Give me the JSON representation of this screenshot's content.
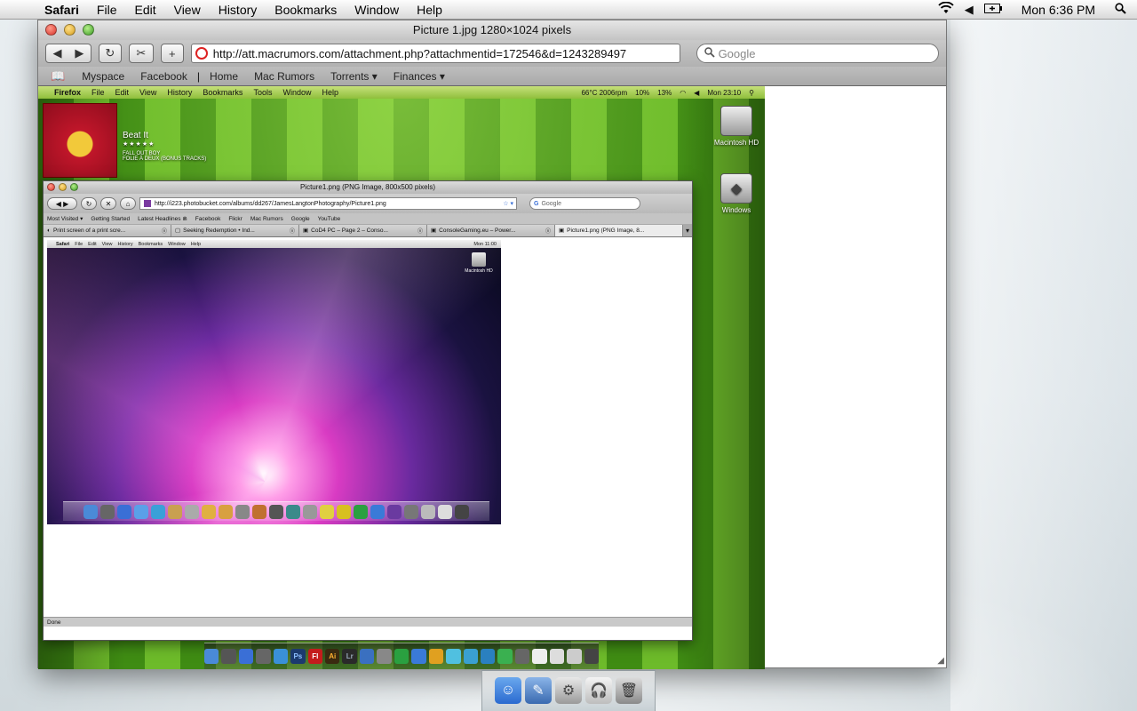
{
  "menubar": {
    "app": "Safari",
    "items": [
      "File",
      "Edit",
      "View",
      "History",
      "Bookmarks",
      "Window",
      "Help"
    ],
    "clock": "Mon 6:36 PM"
  },
  "safari": {
    "title": "Picture 1.jpg 1280×1024 pixels",
    "url": "http://att.macrumors.com/attachment.php?attachmentid=172546&d=1243289497",
    "search_placeholder": "Google",
    "bookmarks": [
      "Myspace",
      "Facebook",
      "Home",
      "Mac Rumors",
      "Torrents ▾",
      "Finances ▾"
    ]
  },
  "image": {
    "menubar": {
      "app": "Firefox",
      "items": [
        "File",
        "Edit",
        "View",
        "History",
        "Bookmarks",
        "Tools",
        "Window",
        "Help"
      ],
      "temp": "66°C",
      "rpm": "2006rpm",
      "cpu1": "10%",
      "cpu2": "13%",
      "clock": "Mon 23:10"
    },
    "track": {
      "title": "Beat It",
      "stars": "★★★★★",
      "artist": "FALL OUT BOY",
      "album": "FOLIE À DEUX (BONUS TRACKS)"
    },
    "drives": [
      "Macintosh HD",
      "Windows"
    ],
    "firefox": {
      "title": "Picture1.png (PNG Image, 800x500 pixels)",
      "url": "http://i223.photobucket.com/albums/dd267/JamesLangtonPhotography/Picture1.png",
      "search_placeholder": "Google",
      "bookmarks": [
        "Most Visited ▾",
        "Getting Started",
        "Latest Headlines ⋒",
        "Facebook",
        "Flickr",
        "Mac Rumors",
        "Google",
        "YouTube"
      ],
      "tabs": [
        {
          "label": "Print screen of a print scre..."
        },
        {
          "label": "Seeking Redemption • Ind..."
        },
        {
          "label": "CoD4 PC – Page 2 – Conso..."
        },
        {
          "label": "ConsoleGaming.eu – Power..."
        },
        {
          "label": "Picture1.png (PNG Image, 8..."
        }
      ],
      "status": "Done"
    },
    "leopard": {
      "menubar": {
        "app": "Safari",
        "items": [
          "File",
          "Edit",
          "View",
          "History",
          "Bookmarks",
          "Window",
          "Help"
        ],
        "clock": "Mon 11:00"
      },
      "drive": "Macintosh HD"
    },
    "dock_labels": [
      "Ps",
      "Fl",
      "Ai",
      "Lr"
    ]
  },
  "colors": {
    "close": "#d8332a",
    "minimize": "#d79f1e",
    "zoom": "#3c9a25"
  }
}
